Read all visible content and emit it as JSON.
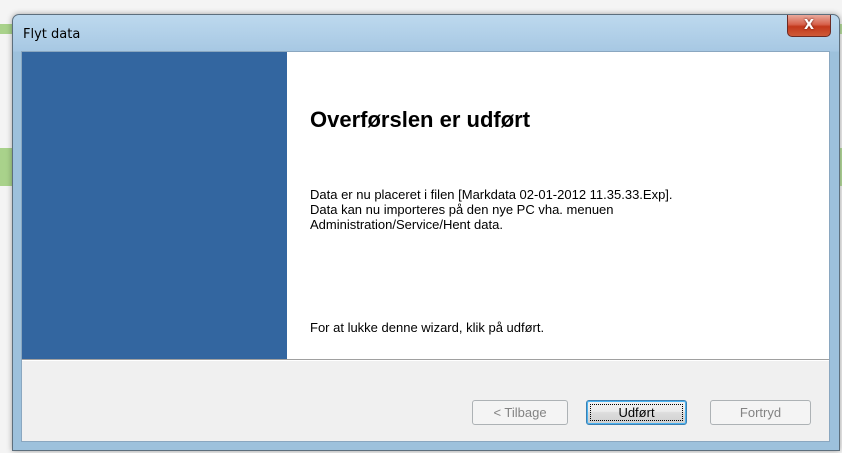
{
  "window": {
    "title": "Flyt data",
    "close_glyph": "X"
  },
  "content": {
    "heading": "Overførslen er udført",
    "lines": [
      "Data er nu placeret i filen [Markdata 02-01-2012 11.35.33.Exp].",
      "Data kan nu importeres på den nye PC vha. menuen",
      "Administration/Service/Hent data."
    ],
    "footer_text": "For at lukke denne wizard, klik på udført."
  },
  "buttons": {
    "back": {
      "label": "< Tilbage",
      "enabled": false
    },
    "finish": {
      "label": "Udført",
      "enabled": true,
      "default": true
    },
    "cancel": {
      "label": "Fortryd",
      "enabled": false
    }
  },
  "colors": {
    "side_panel": "#3366a0",
    "titlebar": "#a7c8e3",
    "close_button": "#c2381b"
  },
  "icons": {
    "close": "close-icon"
  }
}
